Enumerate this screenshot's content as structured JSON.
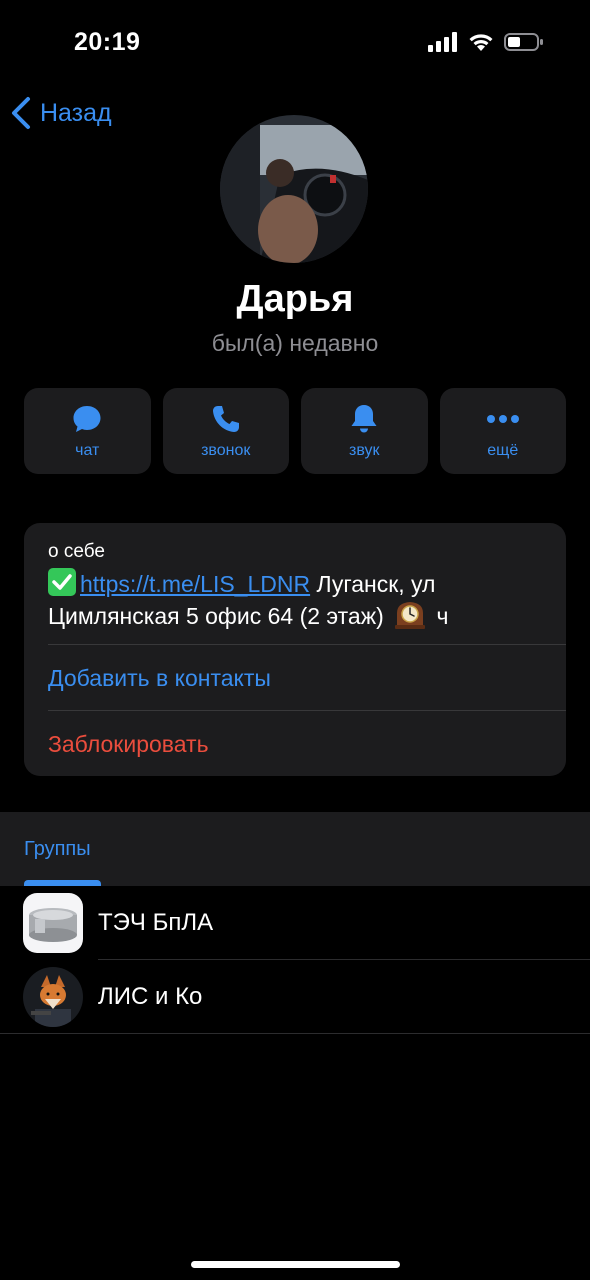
{
  "status_bar": {
    "time": "20:19",
    "icons": [
      "signal-icon",
      "wifi-icon",
      "battery-icon"
    ]
  },
  "nav": {
    "back_label": "Назад"
  },
  "profile": {
    "name": "Дарья",
    "status": "был(а) недавно"
  },
  "actions": [
    {
      "label": "чат",
      "icon": "chat-bubble-icon"
    },
    {
      "label": "звонок",
      "icon": "phone-icon"
    },
    {
      "label": "звук",
      "icon": "bell-icon"
    },
    {
      "label": "ещё",
      "icon": "more-dots-icon"
    }
  ],
  "info": {
    "bio_title": "о себе",
    "bio_link": "https://t.me/LIS_LDNR",
    "bio_text_1": " Луганск, ул",
    "bio_text_2": "Цимлянская 5 офис 64 (2 этаж)",
    "bio_text_3": " ч",
    "add_contact": "Добавить в контакты",
    "block": "Заблокировать"
  },
  "groups": {
    "tab_label": "Группы",
    "items": [
      {
        "name": "ТЭЧ БпЛА"
      },
      {
        "name": "ЛИС и Ко"
      }
    ]
  },
  "colors": {
    "accent": "#3a8ef0",
    "danger": "#eb4d3d",
    "card": "#1c1c1e",
    "secondary_text": "#8e8e93"
  }
}
